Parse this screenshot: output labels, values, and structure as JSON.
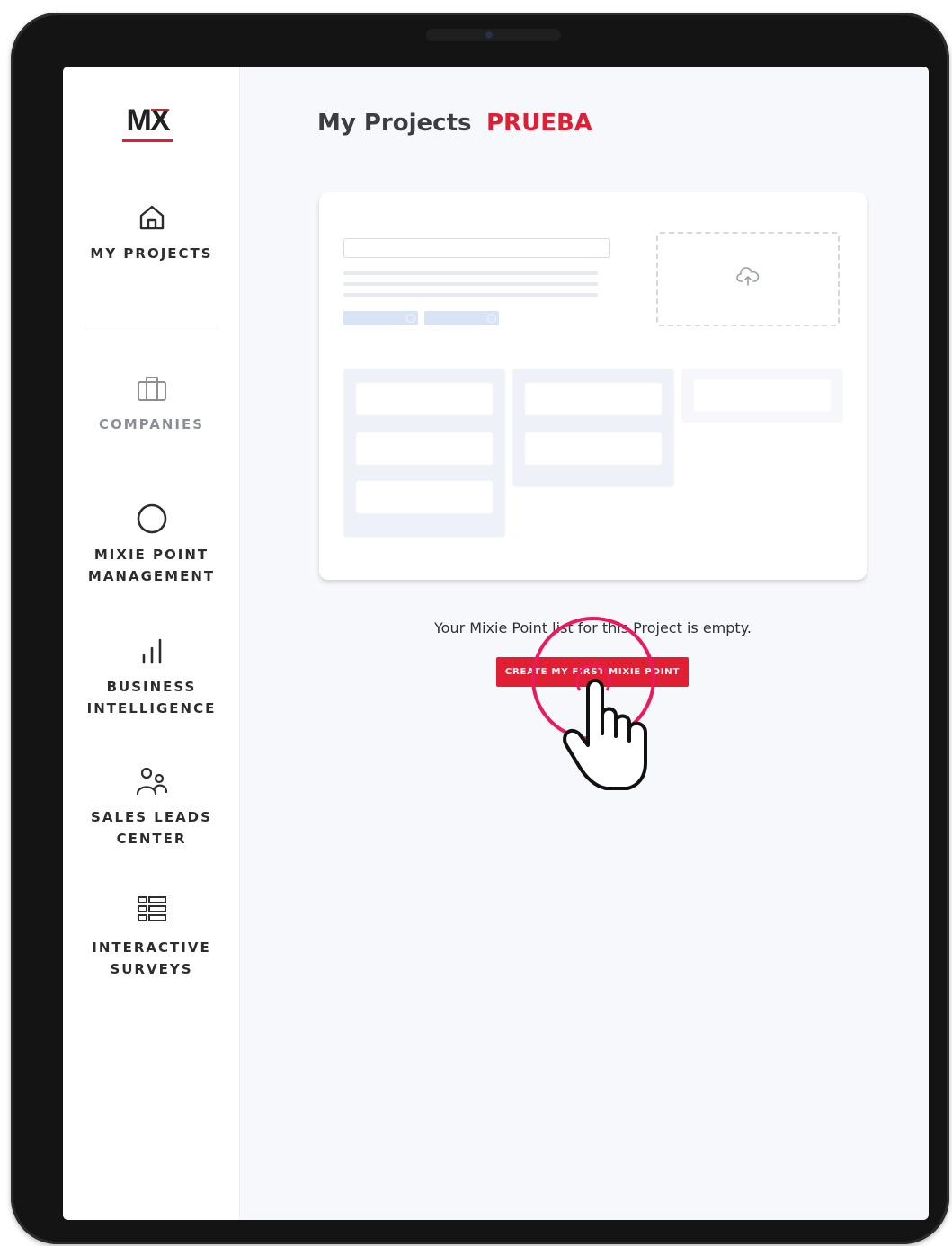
{
  "app": {
    "logo_text": "MX",
    "accent_color": "#e01f35"
  },
  "sidebar": {
    "items": [
      {
        "label": "MY PROJECTS",
        "icon": "home-icon",
        "active": true
      },
      {
        "label": "COMPANIES",
        "icon": "briefcase-icon",
        "active": false
      },
      {
        "label": "MIXIE POINT\nMANAGEMENT",
        "icon": "circle-icon",
        "active": false
      },
      {
        "label": "BUSINESS\nINTELLIGENCE",
        "icon": "bar-chart-icon",
        "active": false
      },
      {
        "label": "SALES LEADS\nCENTER",
        "icon": "users-icon",
        "active": false
      },
      {
        "label": "INTERACTIVE\nSURVEYS",
        "icon": "list-icon",
        "active": false
      }
    ]
  },
  "header": {
    "title": "My Projects",
    "project_name": "PRUEBA"
  },
  "empty_state": {
    "message": "Your Mixie Point list for this Project is empty.",
    "cta_label": "CREATE MY FIRST MIXIE POINT",
    "illustration_icon": "upload-cloud-icon",
    "cursor_icon": "hand-pointer-icon"
  }
}
